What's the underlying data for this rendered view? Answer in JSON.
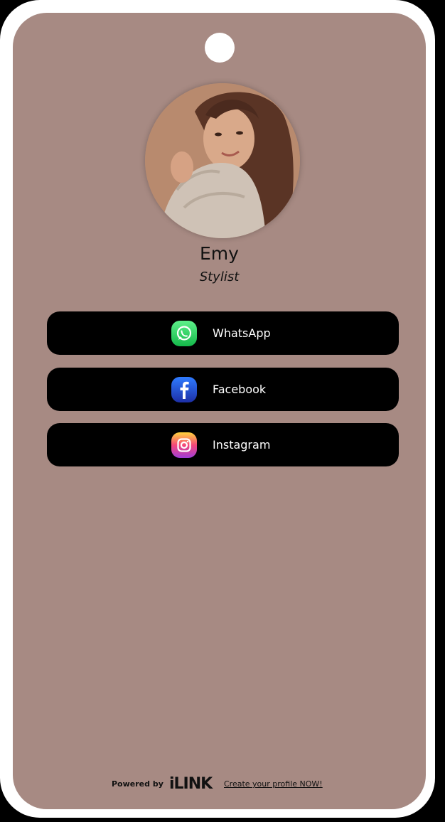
{
  "profile": {
    "name": "Emy",
    "role": "Stylist"
  },
  "links": [
    {
      "label": "WhatsApp",
      "icon": "whatsapp-icon"
    },
    {
      "label": "Facebook",
      "icon": "facebook-icon"
    },
    {
      "label": "Instagram",
      "icon": "instagram-icon"
    }
  ],
  "footer": {
    "powered_by": "Powered by",
    "brand": "iLINK",
    "cta": "Create your profile NOW!"
  },
  "colors": {
    "card_background": "#a78a83",
    "button_background": "#000000",
    "whatsapp": "#25d366",
    "facebook": "#1877f2"
  }
}
